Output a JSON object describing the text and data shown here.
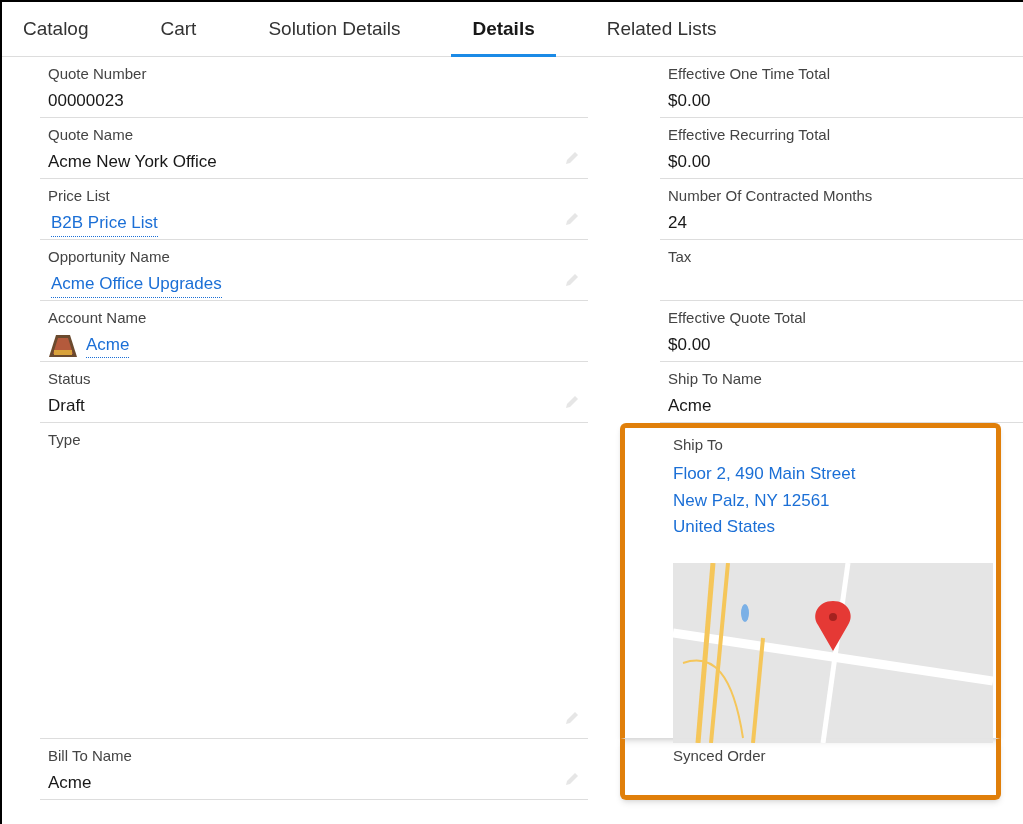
{
  "tabs": [
    {
      "label": "Catalog",
      "selected": false
    },
    {
      "label": "Cart",
      "selected": false
    },
    {
      "label": "Solution Details",
      "selected": false
    },
    {
      "label": "Details",
      "selected": true
    },
    {
      "label": "Related Lists",
      "selected": false
    }
  ],
  "rows": [
    {
      "left": {
        "label": "Quote Number",
        "kind": "text",
        "value": "00000023",
        "editable": false
      },
      "right": {
        "label": "Effective One Time Total",
        "kind": "text",
        "value": "$0.00",
        "highlighted": false
      }
    },
    {
      "left": {
        "label": "Quote Name",
        "kind": "text",
        "value": "Acme New York Office",
        "editable": true
      },
      "right": {
        "label": "Effective Recurring Total",
        "kind": "text",
        "value": "$0.00",
        "highlighted": false
      }
    },
    {
      "left": {
        "label": "Price List",
        "kind": "link",
        "value": "B2B Price List",
        "editable": true
      },
      "right": {
        "label": "Number Of Contracted Months",
        "kind": "text",
        "value": "24",
        "highlighted": false
      }
    },
    {
      "left": {
        "label": "Opportunity Name",
        "kind": "link",
        "value": "Acme Office Upgrades",
        "editable": true
      },
      "right": {
        "label": "Tax",
        "kind": "empty",
        "highlighted": false
      }
    },
    {
      "left": {
        "label": "Account Name",
        "kind": "account",
        "value": "Acme",
        "editable": false
      },
      "right": {
        "label": "Effective Quote Total",
        "kind": "text",
        "value": "$0.00",
        "highlighted": false
      }
    },
    {
      "left": {
        "label": "Status",
        "kind": "text",
        "value": "Draft",
        "editable": true
      },
      "right": {
        "label": "Ship To Name",
        "kind": "text",
        "value": "Acme",
        "highlighted": false
      }
    },
    {
      "left": {
        "label": "Type",
        "kind": "empty",
        "editable": true
      },
      "right": {
        "label": "Ship To",
        "kind": "address",
        "lines": [
          "Floor 2, 490 Main Street",
          "New Palz, NY 12561",
          "United States"
        ],
        "highlighted": true
      }
    },
    {
      "left": {
        "label": "Bill To Name",
        "kind": "text",
        "value": "Acme",
        "editable": true
      },
      "right": {
        "label": "Synced Order",
        "kind": "empty",
        "highlighted": true
      }
    }
  ]
}
